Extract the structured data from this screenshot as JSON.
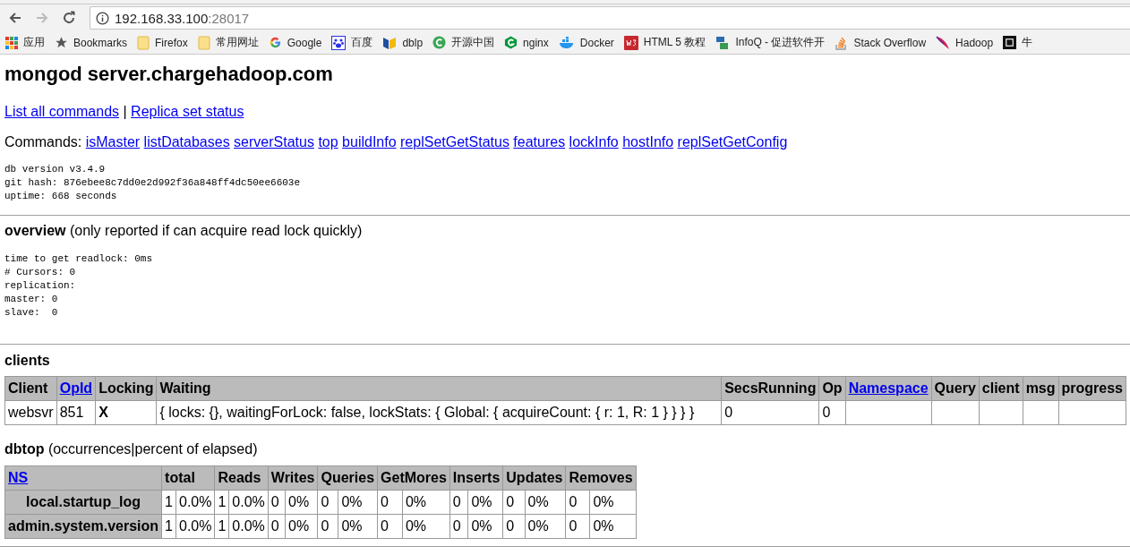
{
  "browser": {
    "back_disabled": false,
    "forward_disabled": true,
    "address": {
      "host": "192.168.33.100",
      "port": ":28017"
    },
    "bookmarks": [
      {
        "label": "应用",
        "kind": "apps"
      },
      {
        "label": "Bookmarks",
        "kind": "star"
      },
      {
        "label": "Firefox",
        "kind": "folder"
      },
      {
        "label": "常用网址",
        "kind": "folder"
      },
      {
        "label": "Google",
        "kind": "google"
      },
      {
        "label": "百度",
        "kind": "paw"
      },
      {
        "label": "dblp",
        "kind": "dblp"
      },
      {
        "label": "开源中国",
        "kind": "c-circle"
      },
      {
        "label": "nginx",
        "kind": "g-hex"
      },
      {
        "label": "Docker",
        "kind": "whale"
      },
      {
        "label": "HTML 5 教程",
        "kind": "w3"
      },
      {
        "label": "InfoQ - 促进软件开",
        "kind": "infoq"
      },
      {
        "label": "Stack Overflow",
        "kind": "stack"
      },
      {
        "label": "Hadoop",
        "kind": "feather"
      },
      {
        "label": "牛",
        "kind": "dark-square"
      }
    ]
  },
  "page": {
    "title": "mongod server.chargehadoop.com",
    "top_links": [
      "List all commands",
      "Replica set status"
    ],
    "separator": "|",
    "commands_label": "Commands:",
    "commands": [
      "isMaster",
      "listDatabases",
      "serverStatus",
      "top",
      "buildInfo",
      "replSetGetStatus",
      "features",
      "lockInfo",
      "hostInfo",
      "replSetGetConfig"
    ],
    "version_info": [
      "db version v3.4.9",
      "git hash: 876ebee8c7dd0e2d992f36a848ff4dc50ee6603e",
      "uptime: 668 seconds"
    ],
    "overview": {
      "heading": "overview",
      "note": "(only reported if can acquire read lock quickly)",
      "lines": [
        "time to get readlock: 0ms",
        "# Cursors: 0",
        "replication:",
        "master: 0",
        "slave:  0"
      ]
    },
    "clients": {
      "heading": "clients",
      "columns": [
        {
          "label": "Client",
          "link": false
        },
        {
          "label": "OpId",
          "link": true
        },
        {
          "label": "Locking",
          "link": false
        },
        {
          "label": "Waiting",
          "link": false
        },
        {
          "label": "SecsRunning",
          "link": false
        },
        {
          "label": "Op",
          "link": false
        },
        {
          "label": "Namespace",
          "link": true
        },
        {
          "label": "Query",
          "link": false
        },
        {
          "label": "client",
          "link": false
        },
        {
          "label": "msg",
          "link": false
        },
        {
          "label": "progress",
          "link": false
        }
      ],
      "rows": [
        {
          "cells": [
            {
              "text": "websvr",
              "bold": false
            },
            {
              "text": "851",
              "bold": false
            },
            {
              "text": "X",
              "bold": true
            },
            {
              "text": "{ locks: {}, waitingForLock: false, lockStats: { Global: { acquireCount: { r: 1, R: 1 } } } }",
              "bold": false
            },
            {
              "text": "0",
              "bold": false
            },
            {
              "text": "0",
              "bold": false
            }
          ]
        }
      ]
    },
    "dbtop": {
      "heading": "dbtop",
      "note": "(occurrences|percent of elapsed)",
      "columns": [
        {
          "label": "NS",
          "link": true
        },
        {
          "label": "total",
          "link": false,
          "colspan": 2
        },
        {
          "label": "Reads",
          "link": false,
          "colspan": 2
        },
        {
          "label": "Writes",
          "link": false,
          "colspan": 2
        },
        {
          "label": "Queries",
          "link": false,
          "colspan": 2
        },
        {
          "label": "GetMores",
          "link": false,
          "colspan": 2
        },
        {
          "label": "Inserts",
          "link": false,
          "colspan": 2
        },
        {
          "label": "Updates",
          "link": false,
          "colspan": 2
        },
        {
          "label": "Removes",
          "link": false,
          "colspan": 2
        }
      ],
      "rows": [
        {
          "cells": [
            "local.startup_log",
            "1",
            "0.0%",
            "1",
            "0.0%",
            "0",
            "0%",
            "0",
            "0%",
            "0",
            "0%",
            "0",
            "0%",
            "0",
            "0%",
            "0",
            "0%"
          ]
        },
        {
          "cells": [
            "admin.system.version",
            "1",
            "0.0%",
            "1",
            "0.0%",
            "0",
            "0%",
            "0",
            "0%",
            "0",
            "0%",
            "0",
            "0%",
            "0",
            "0%",
            "0",
            "0%"
          ]
        }
      ]
    }
  }
}
